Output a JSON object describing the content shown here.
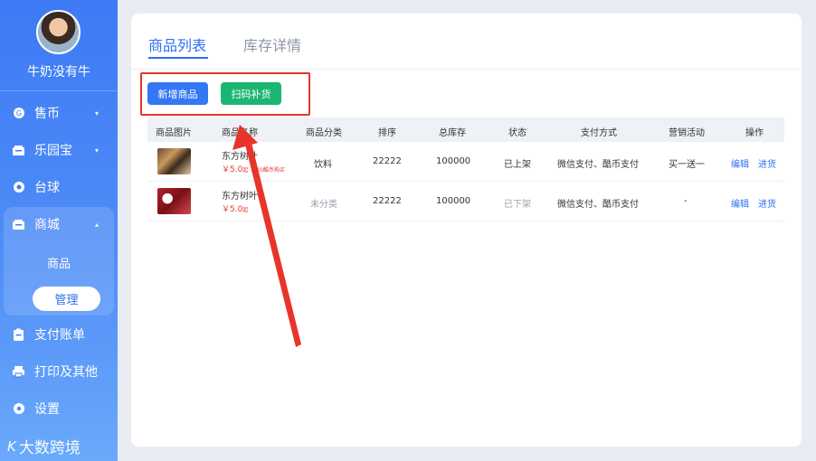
{
  "sidebar": {
    "username": "牛奶没有牛",
    "items": [
      {
        "label": "售币",
        "icon": "coin-icon",
        "caret": "▾"
      },
      {
        "label": "乐园宝",
        "icon": "ticket-icon",
        "caret": "▾"
      },
      {
        "label": "台球",
        "icon": "billiards-icon"
      },
      {
        "label": "商城",
        "icon": "shop-icon",
        "caret": "▴"
      },
      {
        "label": "支付账单",
        "icon": "bill-icon"
      },
      {
        "label": "打印及其他",
        "icon": "printer-icon"
      },
      {
        "label": "设置",
        "icon": "gear-icon"
      }
    ],
    "sub_items": [
      {
        "label": "商品"
      },
      {
        "label": "管理"
      }
    ],
    "logo_text": "大数跨境"
  },
  "tabs": [
    {
      "label": "商品列表"
    },
    {
      "label": "库存详情"
    }
  ],
  "actions": {
    "add_label": "新增商品",
    "scan_label": "扫码补货"
  },
  "table": {
    "columns": [
      "商品图片",
      "商品名称",
      "商品分类",
      "排序",
      "总库存",
      "状态",
      "支付方式",
      "营销活动",
      "操作"
    ],
    "rows": [
      {
        "name": "东方树叶",
        "price": "￥5.0",
        "price_unit": "起",
        "price_note": "或10酷币购买",
        "category": "饮料",
        "sort": "22222",
        "stock": "100000",
        "status": "已上架",
        "payment": "微信支付、酷币支付",
        "promo": "买一送一",
        "edit": "编辑",
        "restock": "进货"
      },
      {
        "name": "东方树叶",
        "price": "￥5.0",
        "price_unit": "起",
        "category": "未分类",
        "sort": "22222",
        "stock": "100000",
        "status": "已下架",
        "payment": "微信支付、酷币支付",
        "promo": "-",
        "edit": "编辑",
        "restock": "进货"
      }
    ]
  },
  "colors": {
    "primary": "#2e6ff0",
    "success": "#1cb672",
    "annotation": "#e8342a"
  }
}
